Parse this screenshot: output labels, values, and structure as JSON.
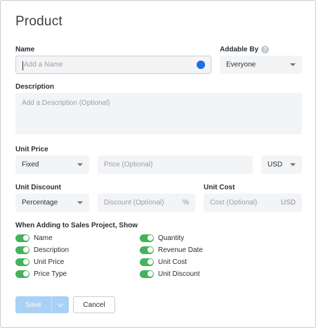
{
  "dialog": {
    "title": "Product"
  },
  "name_field": {
    "label": "Name",
    "placeholder": "Add a Name",
    "status_color": "#1f6fe0"
  },
  "addable_by": {
    "label": "Addable By",
    "help_icon": "?",
    "value": "Everyone"
  },
  "description": {
    "label": "Description",
    "placeholder": "Add a Description (Optional)"
  },
  "unit_price": {
    "label": "Unit Price",
    "type_value": "Fixed",
    "price_placeholder": "Price (Optional)",
    "currency": "USD"
  },
  "unit_discount": {
    "label": "Unit Discount",
    "type_value": "Percentage",
    "discount_placeholder": "Discount (Optional)",
    "suffix": "%"
  },
  "unit_cost": {
    "label": "Unit Cost",
    "placeholder": "Cost (Optional)",
    "suffix": "USD"
  },
  "show_section": {
    "label": "When Adding to Sales Project, Show",
    "toggle_color": "#43b35c",
    "left_toggles": [
      {
        "label": "Name",
        "on": true
      },
      {
        "label": "Description",
        "on": true
      },
      {
        "label": "Unit Price",
        "on": true
      },
      {
        "label": "Price Type",
        "on": true
      }
    ],
    "right_toggles": [
      {
        "label": "Quantity",
        "on": true
      },
      {
        "label": "Revenue Date",
        "on": true
      },
      {
        "label": "Unit Cost",
        "on": true
      },
      {
        "label": "Unit Discount",
        "on": true
      }
    ]
  },
  "buttons": {
    "save_label": "Save",
    "cancel_label": "Cancel"
  }
}
